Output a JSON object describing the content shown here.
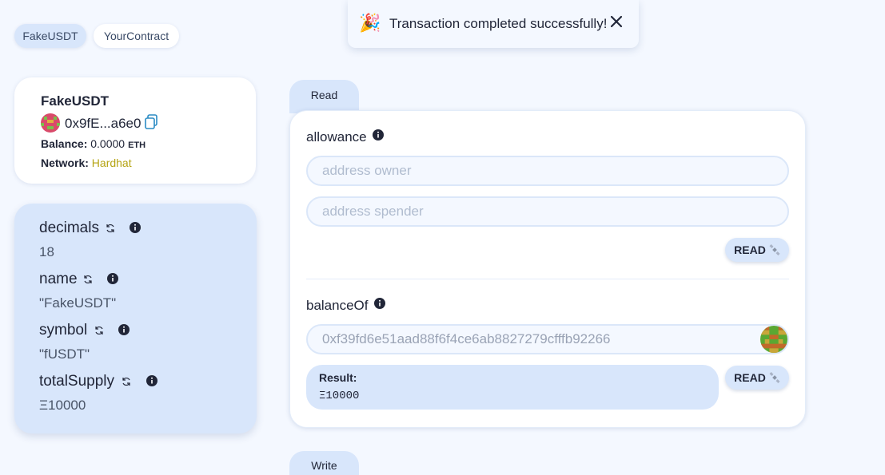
{
  "tabs": [
    {
      "label": "FakeUSDT",
      "active": true
    },
    {
      "label": "YourContract",
      "active": false
    }
  ],
  "toast": {
    "emoji": "🎉",
    "message": "Transaction completed successfully!"
  },
  "contract": {
    "name": "FakeUSDT",
    "address": "0x9fE...a6e0",
    "balance_label": "Balance:",
    "balance_value": "0.0000",
    "balance_unit": "ETH",
    "network_label": "Network:",
    "network_value": "Hardhat"
  },
  "variables": [
    {
      "name": "decimals",
      "value": "18"
    },
    {
      "name": "name",
      "value": "\"FakeUSDT\""
    },
    {
      "name": "symbol",
      "value": "\"fUSDT\""
    },
    {
      "name": "totalSupply",
      "value": "Ξ10000"
    }
  ],
  "read_tab": {
    "label": "Read"
  },
  "write_tab": {
    "label": "Write"
  },
  "functions": {
    "allowance": {
      "name": "allowance",
      "owner_placeholder": "address owner",
      "spender_placeholder": "address spender",
      "button": "READ"
    },
    "balanceOf": {
      "name": "balanceOf",
      "input_value": "0xf39fd6e51aad88f6f4ce6ab8827279cfffb92266",
      "button": "READ",
      "result_label": "Result:",
      "result_value": "Ξ10000"
    }
  },
  "colors": {
    "accent": "#d8e6fb",
    "network": "#b5a414",
    "background": "#f4f8ff"
  }
}
